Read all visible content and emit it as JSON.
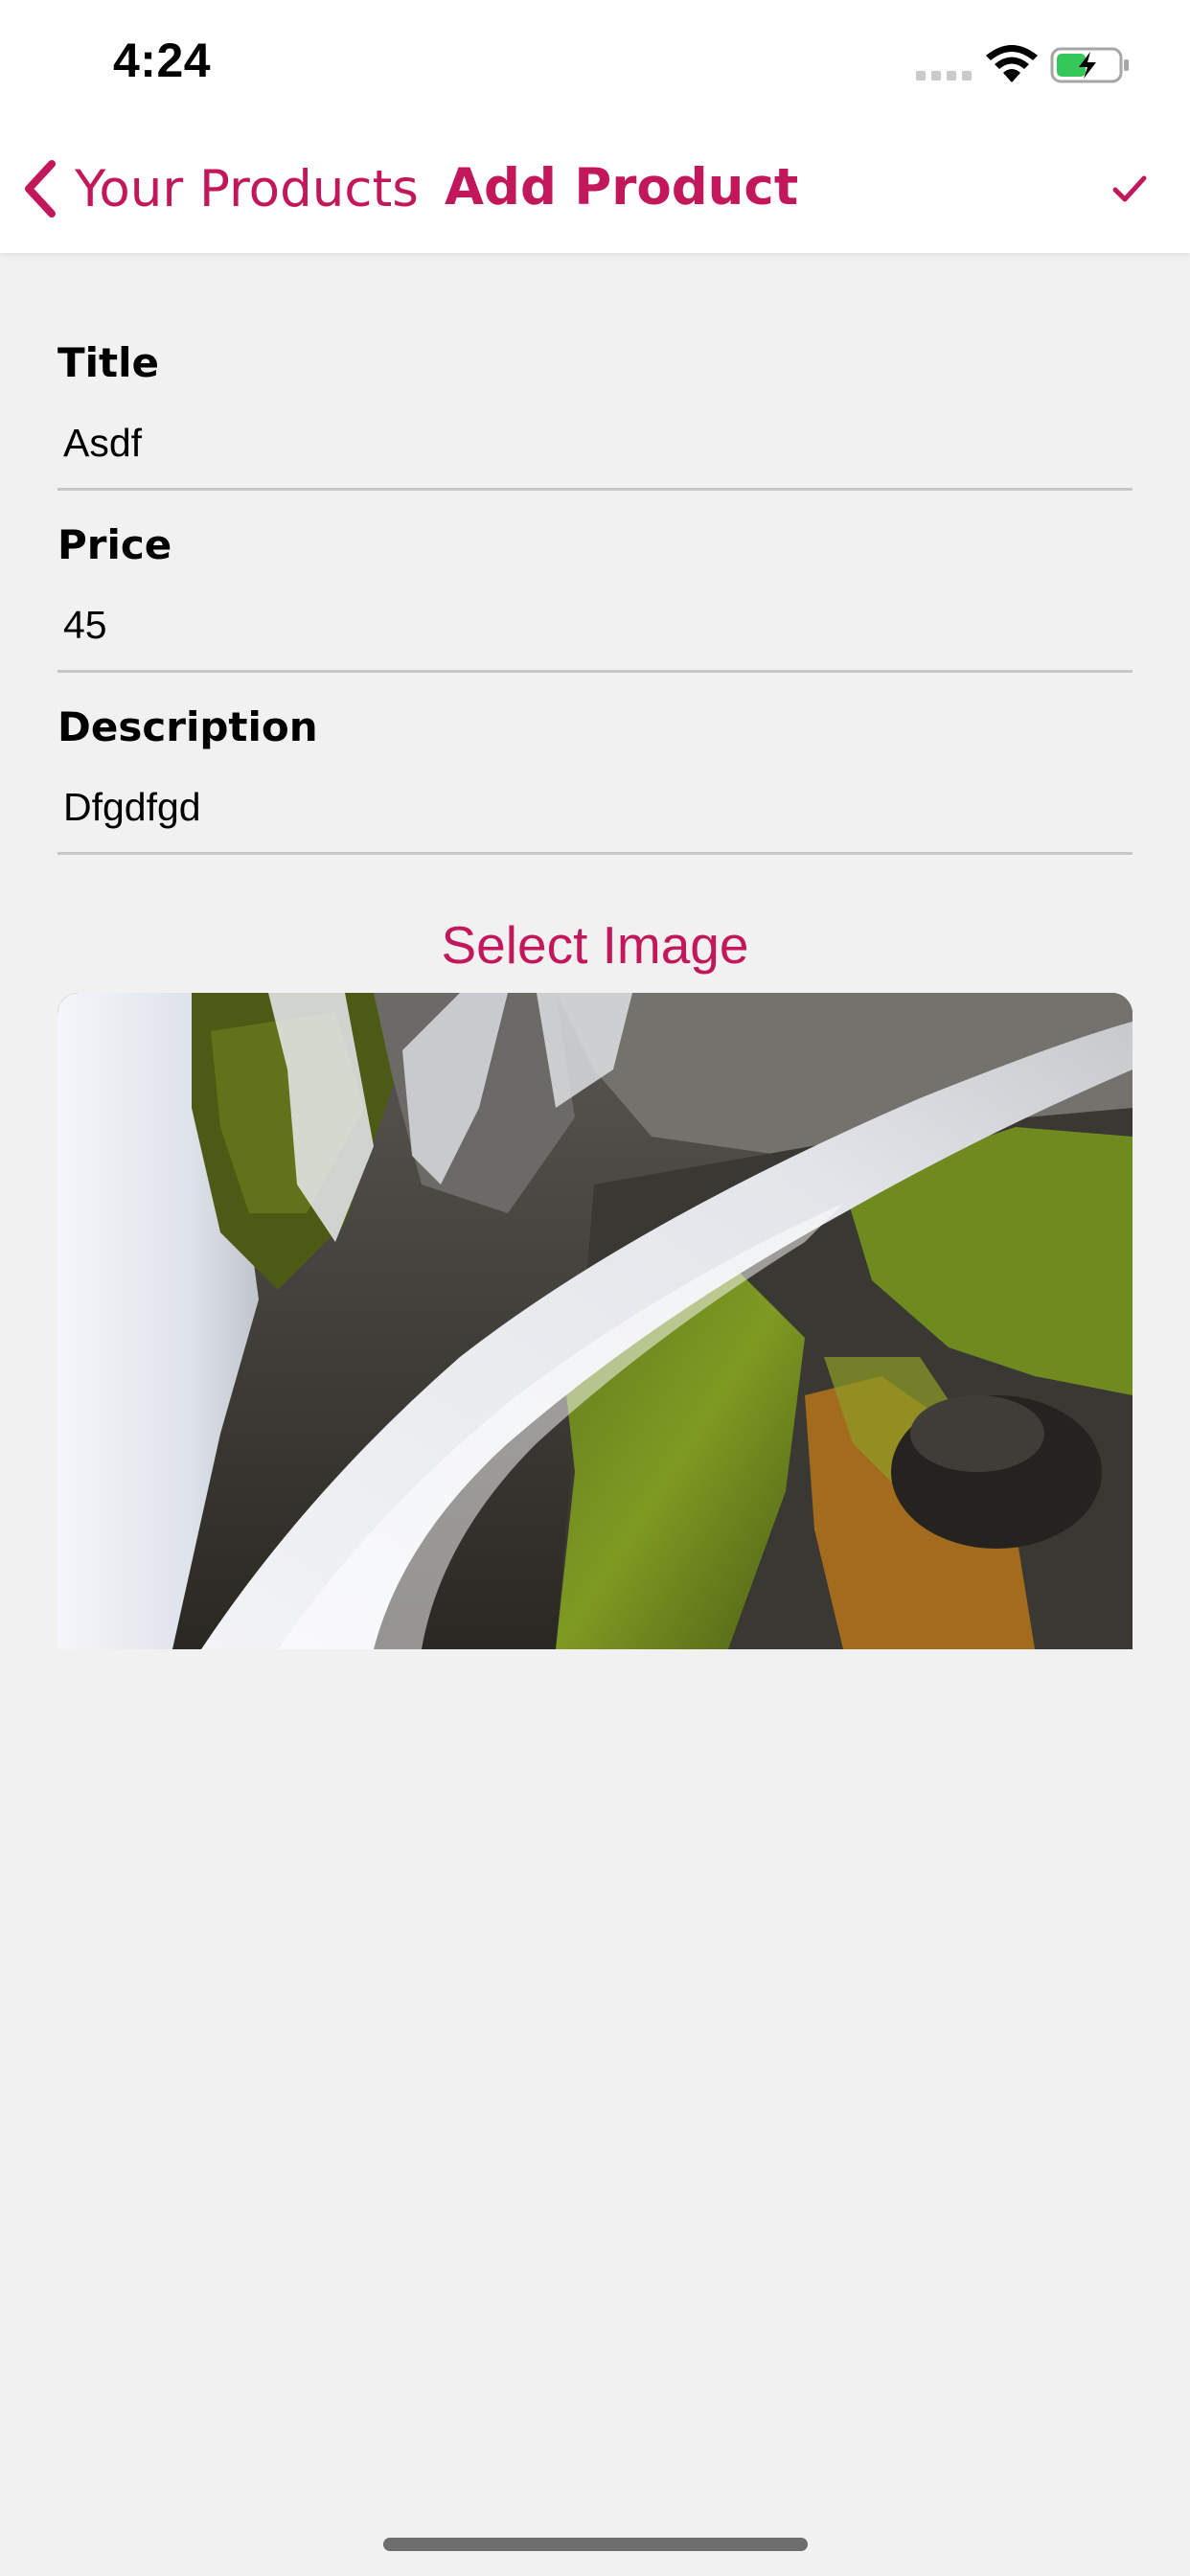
{
  "status_bar": {
    "time": "4:24",
    "icons": [
      "signal-dots-icon",
      "wifi-icon",
      "battery-charging-icon"
    ]
  },
  "header": {
    "back_label": "Your Products",
    "title": "Add Product",
    "confirm_icon": "checkmark-icon"
  },
  "form": {
    "fields": [
      {
        "label": "Title",
        "value": "Asdf"
      },
      {
        "label": "Price",
        "value": "45"
      },
      {
        "label": "Description",
        "value": "Dfgdfgd"
      }
    ],
    "select_image_label": "Select Image"
  },
  "colors": {
    "accent": "#c2185b",
    "background": "#f1f1f1",
    "header_background": "#ffffff",
    "battery_fill": "#34c759"
  }
}
